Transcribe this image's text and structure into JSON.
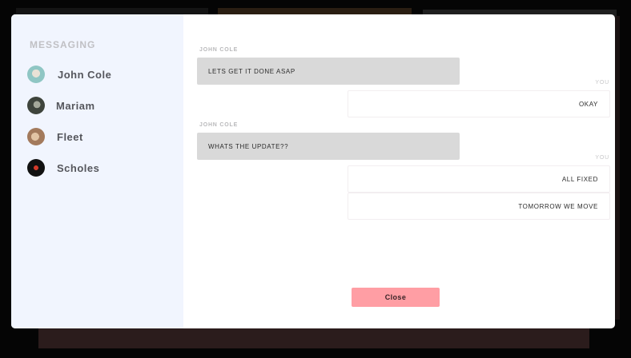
{
  "sidebar": {
    "title": "MESSAGING",
    "contacts": [
      {
        "name": "John Cole",
        "avatar": "avatar-john-cole"
      },
      {
        "name": "Mariam",
        "avatar": "avatar-mariam"
      },
      {
        "name": "Fleet",
        "avatar": "avatar-fleet"
      },
      {
        "name": "Scholes",
        "avatar": "avatar-scholes"
      }
    ]
  },
  "chat": {
    "messages": [
      {
        "from": "JOHN COLE",
        "text": "LETS GET IT DONE ASAP"
      },
      {
        "from": "YOU",
        "text": "OKAY"
      },
      {
        "from": "JOHN COLE",
        "text": "WHATS THE UPDATE??"
      },
      {
        "from": "YOU",
        "text": "ALL FIXED"
      },
      {
        "from": "",
        "text": "TOMORROW WE MOVE"
      }
    ],
    "close_label": "Close"
  },
  "colors": {
    "sidebar_bg": "#f1f5fe",
    "incoming_bg": "#d9d9d9",
    "close_button_bg": "#ff9ea4"
  }
}
